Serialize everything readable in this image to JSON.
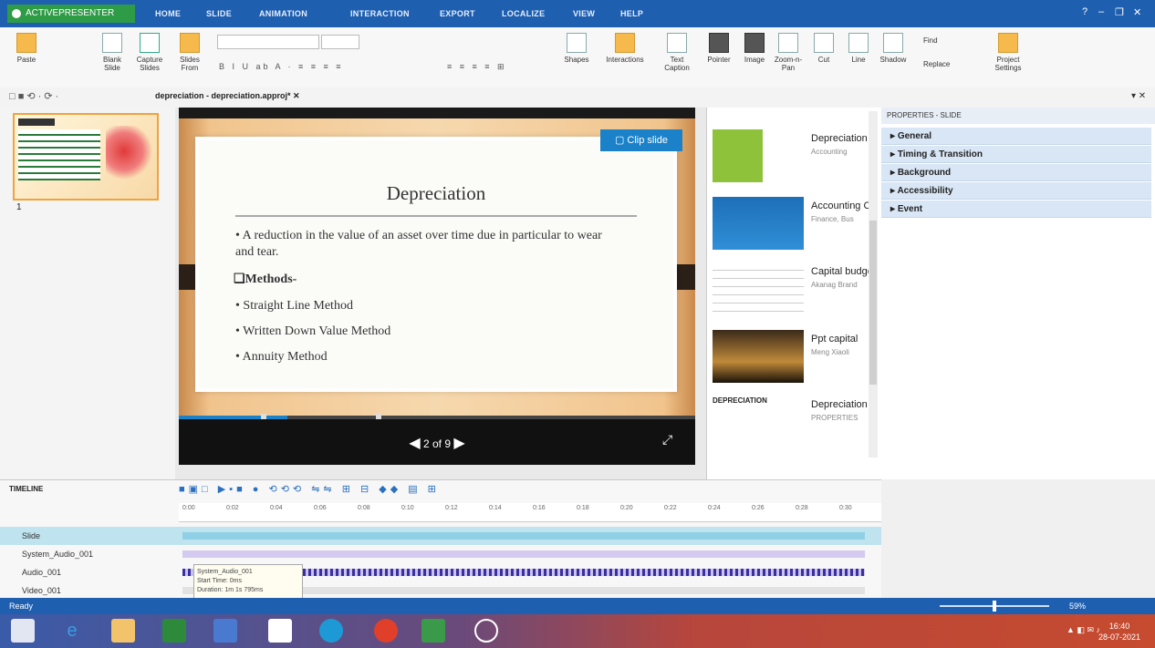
{
  "app": {
    "name": "ACTIVEPRESENTER",
    "tabs": [
      "HOME",
      "SLIDE",
      "ANIMATION",
      "INTERACTION",
      "EXPORT",
      "LOCALIZE",
      "VIEW",
      "HELP"
    ],
    "window_controls": [
      "?",
      "–",
      "❐",
      "✕"
    ]
  },
  "ribbon": {
    "buttons": [
      {
        "label": "Paste"
      },
      {
        "label": "Blank Slide"
      },
      {
        "label": "Capture Slides"
      },
      {
        "label": "Slides From"
      },
      {
        "label": "Shapes"
      },
      {
        "label": "Interactions"
      },
      {
        "label": "Text Caption"
      },
      {
        "label": "Pointer"
      },
      {
        "label": "Image"
      },
      {
        "label": "Zoom-n-Pan"
      },
      {
        "label": "Cut"
      },
      {
        "label": "Line"
      },
      {
        "label": "Shadow"
      },
      {
        "label": "Find"
      },
      {
        "label": "Replace"
      },
      {
        "label": "Project Settings"
      }
    ]
  },
  "document": {
    "tab_label": "depreciation - depreciation.approj* ✕"
  },
  "slide_panel": {
    "slide_number": "1"
  },
  "slide": {
    "title": "Depreciation",
    "bullet1": "• A reduction in the value of an asset over time due in particular to wear and tear.",
    "methods_heading": "❑Methods-",
    "methods": [
      "• Straight Line Method",
      "• Written Down Value Method",
      "• Annuity Method"
    ],
    "clip_button": "Clip slide",
    "pager": "2 of 9"
  },
  "library": {
    "items": [
      {
        "title": "Depreciation methods",
        "sub": "Accounting"
      },
      {
        "title": "Accounting Cash Flow",
        "sub": "Finance, Bus"
      },
      {
        "title": "Capital budgeting",
        "sub": "Akanag Brand"
      },
      {
        "title": "Ppt capital",
        "sub": "Meng Xiaoli"
      },
      {
        "title": "Depreciation",
        "sub": "PROPERTIES",
        "thumb_text": "DEPRECIATION"
      }
    ]
  },
  "properties": {
    "header": "PROPERTIES - SLIDE",
    "sections": [
      "General",
      "Timing & Transition",
      "Background",
      "Accessibility",
      "Event"
    ]
  },
  "timeline": {
    "title": "TIMELINE",
    "rows": [
      "Slide",
      "System_Audio_001",
      "Audio_001",
      "Video_001"
    ],
    "tooltip": [
      "System_Audio_001",
      "Start Time: 0ms",
      "Duration: 1m 1s 795ms"
    ],
    "ticks": [
      "0:00",
      "0:02",
      "0:04",
      "0:06",
      "0:08",
      "0:10",
      "0:12",
      "0:14",
      "0:16",
      "0:18",
      "0:20",
      "0:22",
      "0:24",
      "0:26",
      "0:28",
      "0:30"
    ]
  },
  "status": {
    "text": "Ready",
    "zoom": "59%"
  },
  "taskbar": {
    "time": "16:40",
    "date": "28-07-2021"
  },
  "colors": {
    "titlebar": "#1f5fb0",
    "app_button": "#2e9b46",
    "clip_button": "#1b82c9",
    "property_row": "#d9e6f5"
  }
}
